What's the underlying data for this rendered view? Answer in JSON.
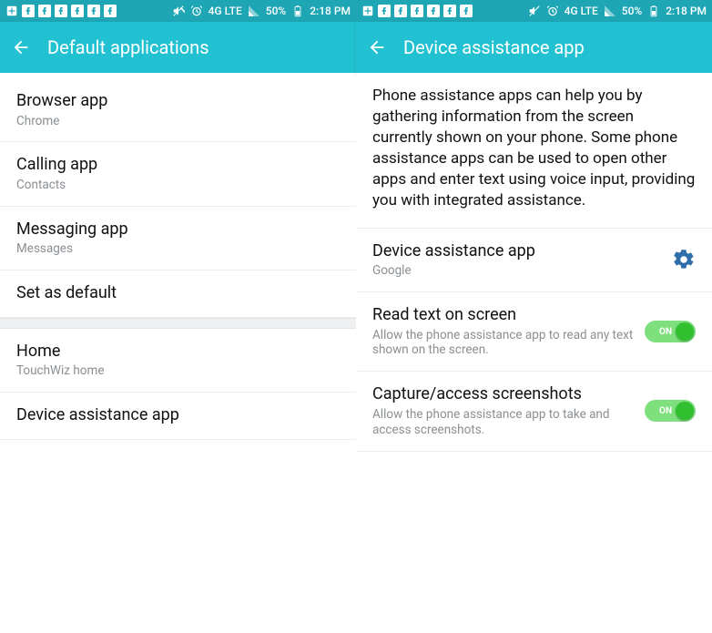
{
  "status": {
    "battery": "50%",
    "time": "2:18 PM",
    "network": "4G LTE"
  },
  "left": {
    "title": "Default applications",
    "items": [
      {
        "title": "Browser app",
        "sub": "Chrome"
      },
      {
        "title": "Calling app",
        "sub": "Contacts"
      },
      {
        "title": "Messaging app",
        "sub": "Messages"
      },
      {
        "title": "Set as default"
      }
    ],
    "group2": [
      {
        "title": "Home",
        "sub": "TouchWiz home"
      },
      {
        "title": "Device assistance app"
      }
    ]
  },
  "right": {
    "title": "Device assistance app",
    "description": "Phone assistance apps can help you by gathering information from the screen currently shown on your phone. Some phone assistance apps can be used to open other apps and enter text using voice input, providing you with integrated assistance.",
    "assist": {
      "title": "Device assistance app",
      "sub": "Google"
    },
    "toggles": [
      {
        "title": "Read text on screen",
        "sub": "Allow the phone assistance app to read any text shown on the screen.",
        "state": "ON"
      },
      {
        "title": "Capture/access screenshots",
        "sub": "Allow the phone assistance app to take and access screenshots.",
        "state": "ON"
      }
    ]
  }
}
